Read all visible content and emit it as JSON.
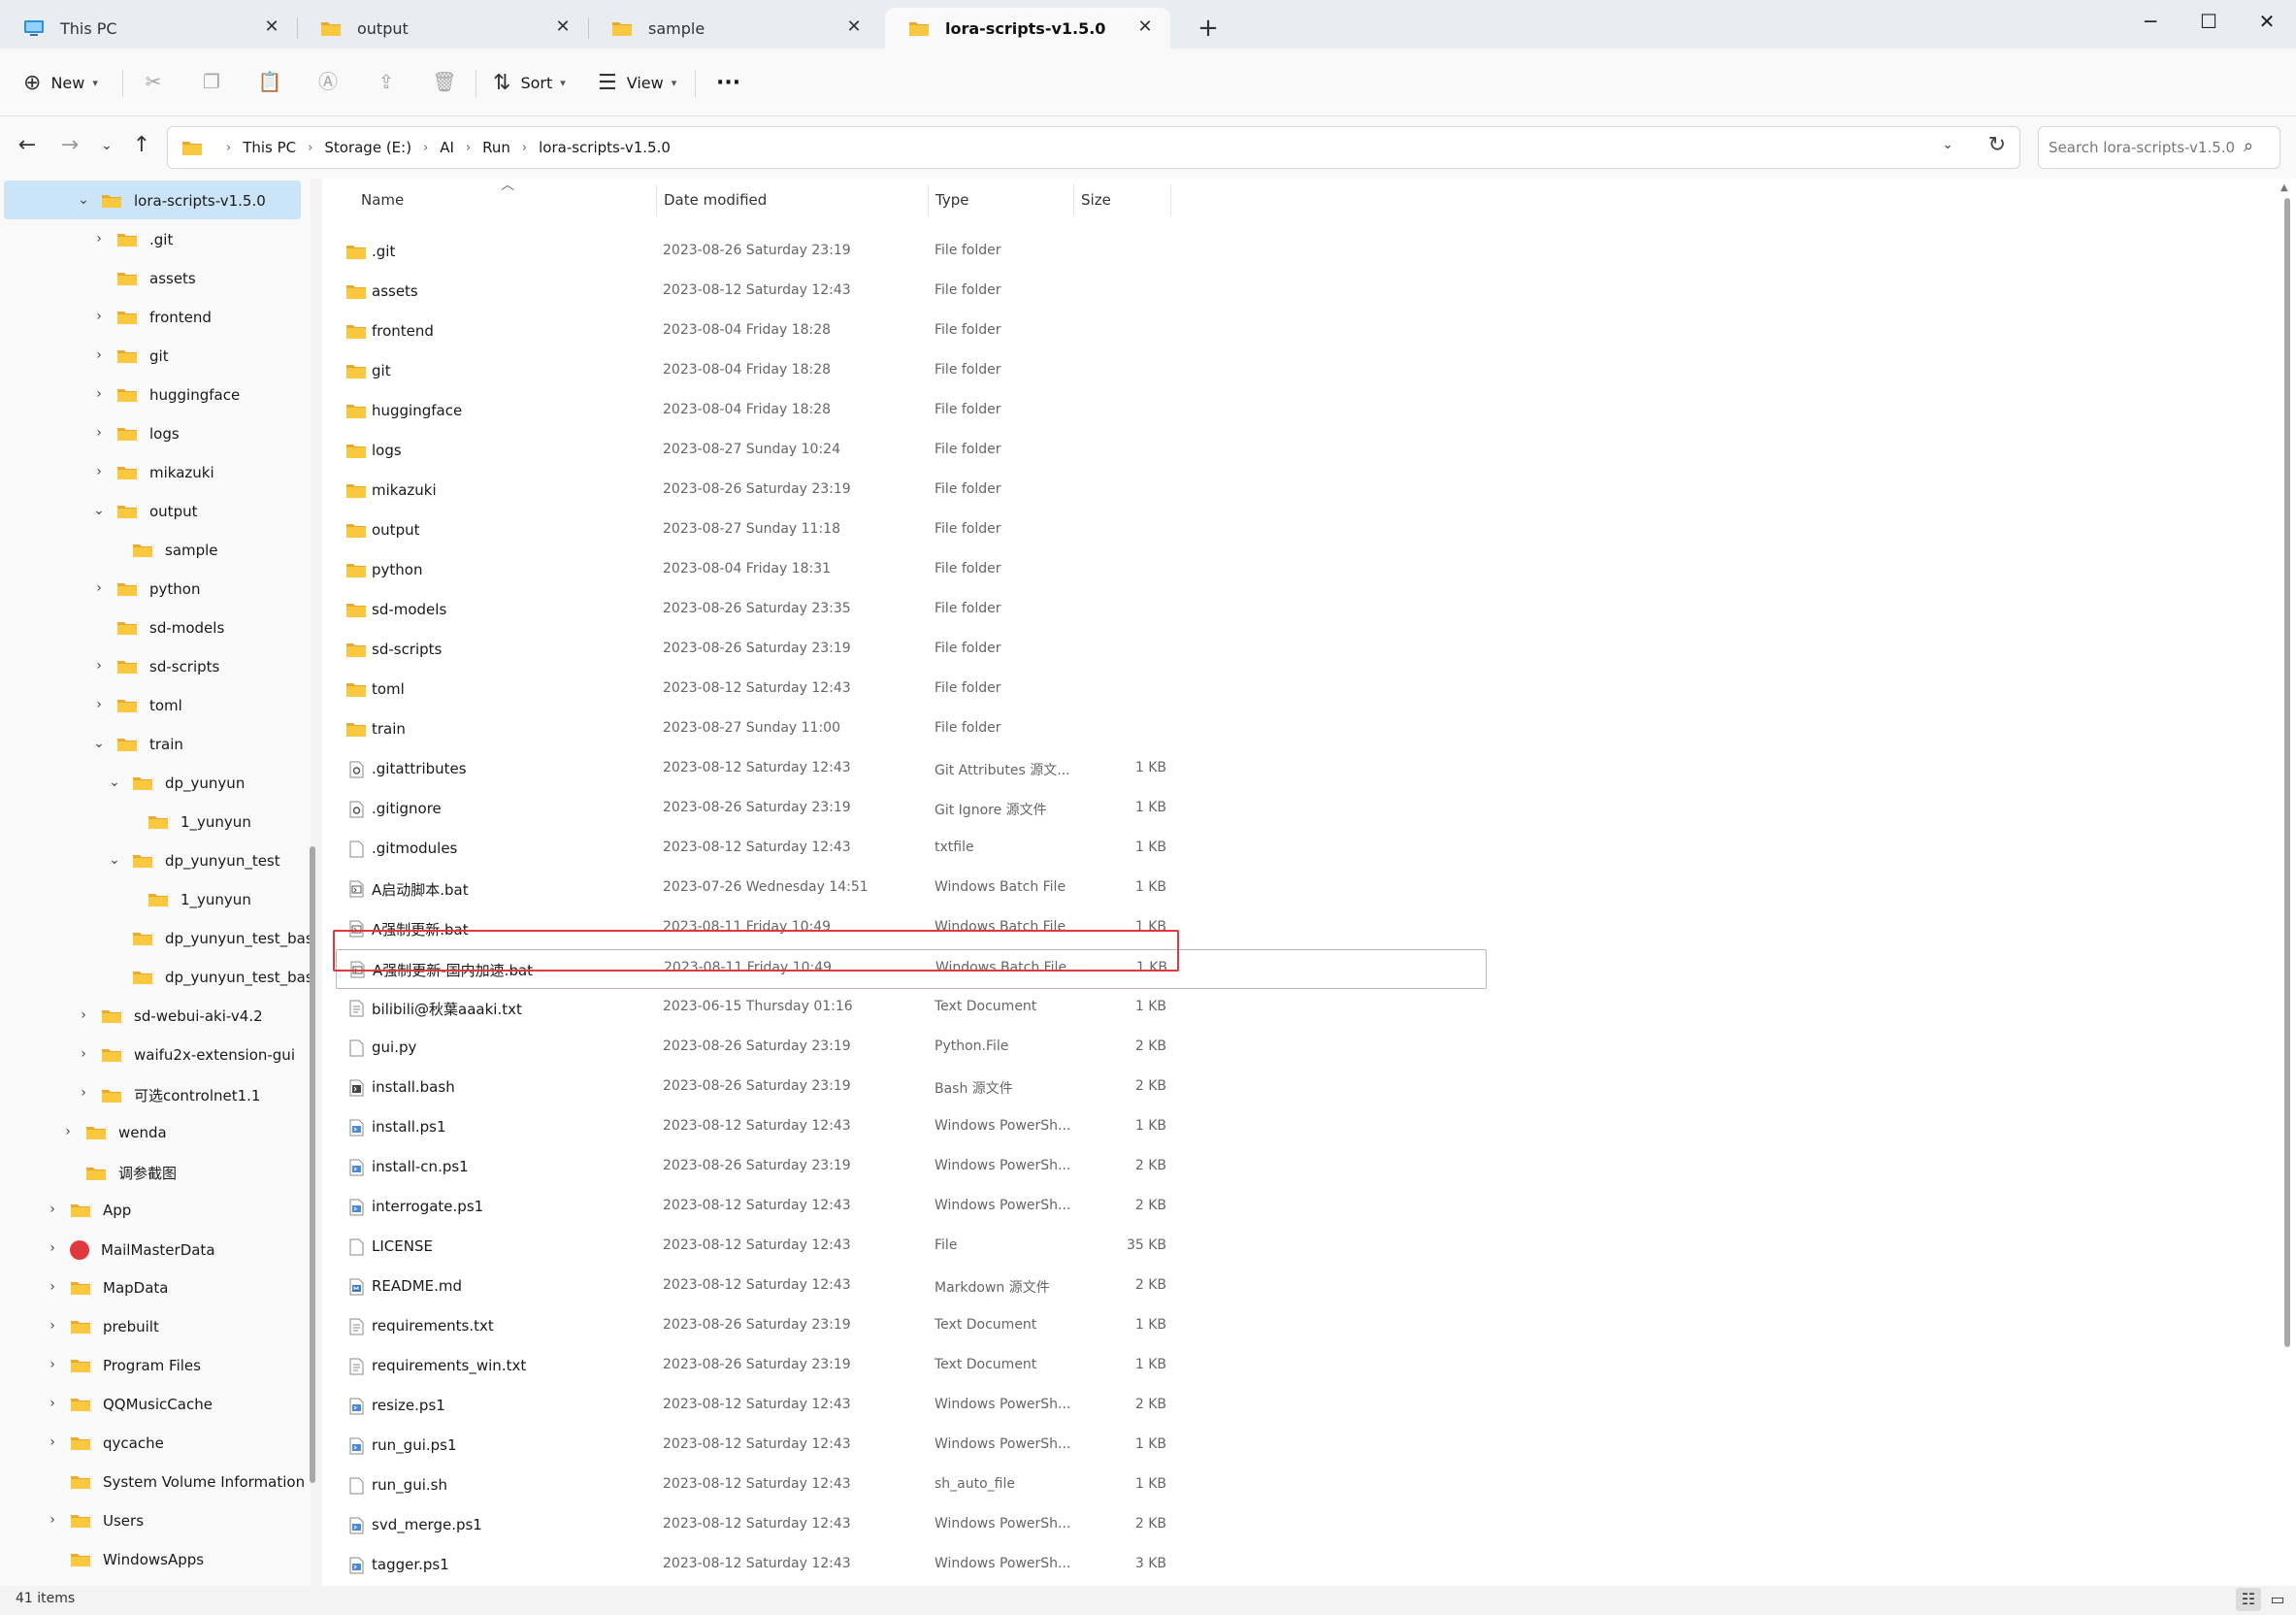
{
  "tabs": [
    {
      "label": "This PC",
      "icon": "monitor-icon",
      "left": 0
    },
    {
      "label": "output",
      "icon": "folder-icon"
    },
    {
      "label": "sample",
      "icon": "folder-icon"
    },
    {
      "label": "lora-scripts-v1.5.0",
      "icon": "folder-icon",
      "active": true
    }
  ],
  "colors": {
    "folder": "#f9c83e",
    "folder_dark": "#e8a92c",
    "selection": "#cce4f7",
    "highlight": "#e0383e"
  },
  "toolbar": {
    "new_label": "New",
    "sort_label": "Sort",
    "view_label": "View",
    "more_label": "···"
  },
  "breadcrumb": [
    "This PC",
    "Storage (E:)",
    "AI",
    "Run",
    "lora-scripts-v1.5.0"
  ],
  "search": {
    "placeholder": "Search lora-scripts-v1.5.0"
  },
  "nav": [
    {
      "label": "lora-scripts-v1.5.0",
      "level": 0,
      "chevron": "down",
      "selected": true
    },
    {
      "label": ".git",
      "level": 1,
      "chevron": "right"
    },
    {
      "label": "assets",
      "level": 1,
      "chevron": ""
    },
    {
      "label": "frontend",
      "level": 1,
      "chevron": "right"
    },
    {
      "label": "git",
      "level": 1,
      "chevron": "right"
    },
    {
      "label": "huggingface",
      "level": 1,
      "chevron": "right"
    },
    {
      "label": "logs",
      "level": 1,
      "chevron": "right"
    },
    {
      "label": "mikazuki",
      "level": 1,
      "chevron": "right"
    },
    {
      "label": "output",
      "level": 1,
      "chevron": "down"
    },
    {
      "label": "sample",
      "level": 2,
      "chevron": ""
    },
    {
      "label": "python",
      "level": 1,
      "chevron": "right"
    },
    {
      "label": "sd-models",
      "level": 1,
      "chevron": ""
    },
    {
      "label": "sd-scripts",
      "level": 1,
      "chevron": "right"
    },
    {
      "label": "toml",
      "level": 1,
      "chevron": "right"
    },
    {
      "label": "train",
      "level": 1,
      "chevron": "down"
    },
    {
      "label": "dp_yunyun",
      "level": 2,
      "chevron": "down"
    },
    {
      "label": "1_yunyun",
      "level": 3,
      "chevron": ""
    },
    {
      "label": "dp_yunyun_test",
      "level": 2,
      "chevron": "down"
    },
    {
      "label": "1_yunyun",
      "level": 3,
      "chevron": ""
    },
    {
      "label": "dp_yunyun_test_base_pic_in",
      "level": 2,
      "chevron": ""
    },
    {
      "label": "dp_yunyun_test_base_pic_ou",
      "level": 2,
      "chevron": ""
    },
    {
      "label": "sd-webui-aki-v4.2",
      "level": 0,
      "chevron": "right"
    },
    {
      "label": "waifu2x-extension-gui",
      "level": 0,
      "chevron": "right"
    },
    {
      "label": "可选controlnet1.1",
      "level": 0,
      "chevron": "right"
    },
    {
      "label": "wenda",
      "level": -1,
      "chevron": "right"
    },
    {
      "label": "调参截图",
      "level": -1,
      "chevron": ""
    },
    {
      "label": "App",
      "level": -2,
      "chevron": "right"
    },
    {
      "label": "MailMasterData",
      "level": -2,
      "chevron": "right",
      "icon": "mailmaster-icon"
    },
    {
      "label": "MapData",
      "level": -2,
      "chevron": "right"
    },
    {
      "label": "prebuilt",
      "level": -2,
      "chevron": "right"
    },
    {
      "label": "Program Files",
      "level": -2,
      "chevron": "right"
    },
    {
      "label": "QQMusicCache",
      "level": -2,
      "chevron": "right"
    },
    {
      "label": "qycache",
      "level": -2,
      "chevron": "right"
    },
    {
      "label": "System Volume Information",
      "level": -2,
      "chevron": ""
    },
    {
      "label": "Users",
      "level": -2,
      "chevron": "right"
    },
    {
      "label": "WindowsApps",
      "level": -2,
      "chevron": ""
    }
  ],
  "columns": {
    "name": "Name",
    "date": "Date modified",
    "type": "Type",
    "size": "Size"
  },
  "files": [
    {
      "name": ".git",
      "date": "2023-08-26 Saturday 23:19",
      "type": "File folder",
      "size": "",
      "icon": "folder"
    },
    {
      "name": "assets",
      "date": "2023-08-12 Saturday 12:43",
      "type": "File folder",
      "size": "",
      "icon": "folder"
    },
    {
      "name": "frontend",
      "date": "2023-08-04 Friday 18:28",
      "type": "File folder",
      "size": "",
      "icon": "folder"
    },
    {
      "name": "git",
      "date": "2023-08-04 Friday 18:28",
      "type": "File folder",
      "size": "",
      "icon": "folder"
    },
    {
      "name": "huggingface",
      "date": "2023-08-04 Friday 18:28",
      "type": "File folder",
      "size": "",
      "icon": "folder"
    },
    {
      "name": "logs",
      "date": "2023-08-27 Sunday 10:24",
      "type": "File folder",
      "size": "",
      "icon": "folder"
    },
    {
      "name": "mikazuki",
      "date": "2023-08-26 Saturday 23:19",
      "type": "File folder",
      "size": "",
      "icon": "folder"
    },
    {
      "name": "output",
      "date": "2023-08-27 Sunday 11:18",
      "type": "File folder",
      "size": "",
      "icon": "folder"
    },
    {
      "name": "python",
      "date": "2023-08-04 Friday 18:31",
      "type": "File folder",
      "size": "",
      "icon": "folder"
    },
    {
      "name": "sd-models",
      "date": "2023-08-26 Saturday 23:35",
      "type": "File folder",
      "size": "",
      "icon": "folder"
    },
    {
      "name": "sd-scripts",
      "date": "2023-08-26 Saturday 23:19",
      "type": "File folder",
      "size": "",
      "icon": "folder"
    },
    {
      "name": "toml",
      "date": "2023-08-12 Saturday 12:43",
      "type": "File folder",
      "size": "",
      "icon": "folder"
    },
    {
      "name": "train",
      "date": "2023-08-27 Sunday 11:00",
      "type": "File folder",
      "size": "",
      "icon": "folder"
    },
    {
      "name": ".gitattributes",
      "date": "2023-08-12 Saturday 12:43",
      "type": "Git Attributes 源文...",
      "size": "1 KB",
      "icon": "gear"
    },
    {
      "name": ".gitignore",
      "date": "2023-08-26 Saturday 23:19",
      "type": "Git Ignore 源文件",
      "size": "1 KB",
      "icon": "gear"
    },
    {
      "name": ".gitmodules",
      "date": "2023-08-12 Saturday 12:43",
      "type": "txtfile",
      "size": "1 KB",
      "icon": "file"
    },
    {
      "name": "A启动脚本.bat",
      "date": "2023-07-26 Wednesday 14:51",
      "type": "Windows Batch File",
      "size": "1 KB",
      "icon": "bat"
    },
    {
      "name": "A强制更新.bat",
      "date": "2023-08-11 Friday 10:49",
      "type": "Windows Batch File",
      "size": "1 KB",
      "icon": "bat"
    },
    {
      "name": "A强制更新-国内加速.bat",
      "date": "2023-08-11 Friday 10:49",
      "type": "Windows Batch File",
      "size": "1 KB",
      "icon": "bat",
      "focus": true
    },
    {
      "name": "bilibili@秋葉aaaki.txt",
      "date": "2023-06-15 Thursday 01:16",
      "type": "Text Document",
      "size": "1 KB",
      "icon": "text"
    },
    {
      "name": "gui.py",
      "date": "2023-08-26 Saturday 23:19",
      "type": "Python.File",
      "size": "2 KB",
      "icon": "file"
    },
    {
      "name": "install.bash",
      "date": "2023-08-26 Saturday 23:19",
      "type": "Bash 源文件",
      "size": "2 KB",
      "icon": "bash"
    },
    {
      "name": "install.ps1",
      "date": "2023-08-12 Saturday 12:43",
      "type": "Windows PowerSh...",
      "size": "1 KB",
      "icon": "ps"
    },
    {
      "name": "install-cn.ps1",
      "date": "2023-08-26 Saturday 23:19",
      "type": "Windows PowerSh...",
      "size": "2 KB",
      "icon": "ps"
    },
    {
      "name": "interrogate.ps1",
      "date": "2023-08-12 Saturday 12:43",
      "type": "Windows PowerSh...",
      "size": "2 KB",
      "icon": "ps"
    },
    {
      "name": "LICENSE",
      "date": "2023-08-12 Saturday 12:43",
      "type": "File",
      "size": "35 KB",
      "icon": "file"
    },
    {
      "name": "README.md",
      "date": "2023-08-12 Saturday 12:43",
      "type": "Markdown 源文件",
      "size": "2 KB",
      "icon": "md"
    },
    {
      "name": "requirements.txt",
      "date": "2023-08-26 Saturday 23:19",
      "type": "Text Document",
      "size": "1 KB",
      "icon": "text"
    },
    {
      "name": "requirements_win.txt",
      "date": "2023-08-26 Saturday 23:19",
      "type": "Text Document",
      "size": "1 KB",
      "icon": "text"
    },
    {
      "name": "resize.ps1",
      "date": "2023-08-12 Saturday 12:43",
      "type": "Windows PowerSh...",
      "size": "2 KB",
      "icon": "ps"
    },
    {
      "name": "run_gui.ps1",
      "date": "2023-08-12 Saturday 12:43",
      "type": "Windows PowerSh...",
      "size": "1 KB",
      "icon": "ps"
    },
    {
      "name": "run_gui.sh",
      "date": "2023-08-12 Saturday 12:43",
      "type": "sh_auto_file",
      "size": "1 KB",
      "icon": "file"
    },
    {
      "name": "svd_merge.ps1",
      "date": "2023-08-12 Saturday 12:43",
      "type": "Windows PowerSh...",
      "size": "2 KB",
      "icon": "ps"
    },
    {
      "name": "tagger.ps1",
      "date": "2023-08-12 Saturday 12:43",
      "type": "Windows PowerSh...",
      "size": "3 KB",
      "icon": "ps"
    }
  ],
  "status": {
    "items": "41 items"
  }
}
